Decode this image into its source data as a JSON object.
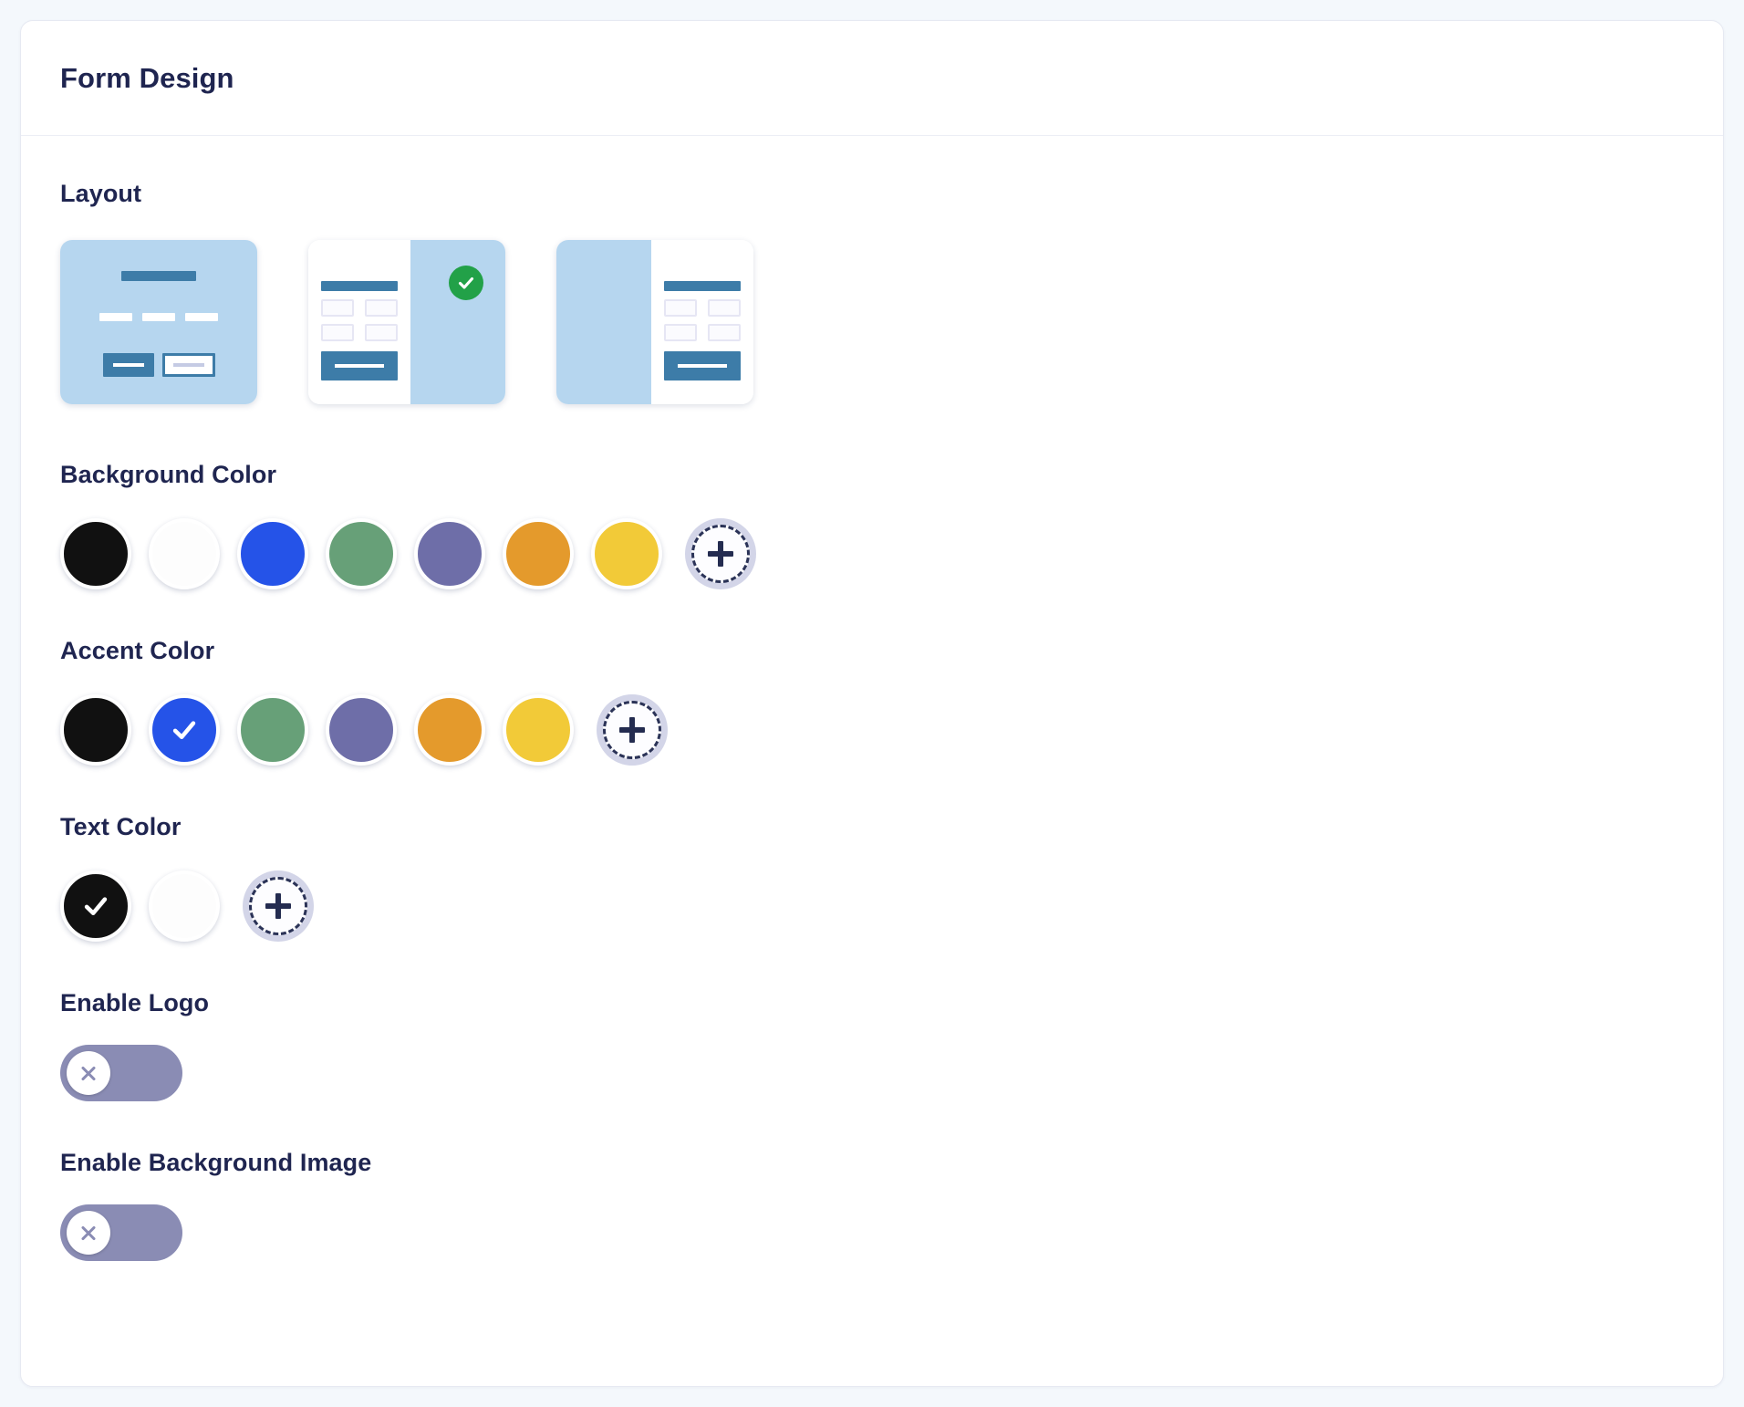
{
  "header": {
    "title": "Form Design"
  },
  "sections": {
    "layout": {
      "label": "Layout",
      "options": [
        {
          "name": "centered-layout",
          "selected": false
        },
        {
          "name": "form-left-image-right-layout",
          "selected": true
        },
        {
          "name": "image-left-form-right-layout",
          "selected": false
        }
      ],
      "selected_index": 1,
      "selected_badge_icon": "check-icon"
    },
    "background_color": {
      "label": "Background Color",
      "swatches": [
        {
          "name": "black",
          "hex": "#111111",
          "selected": false
        },
        {
          "name": "white",
          "hex": "#fdfdfd",
          "selected": false
        },
        {
          "name": "blue",
          "hex": "#2553e8",
          "selected": false
        },
        {
          "name": "green",
          "hex": "#67a078",
          "selected": false
        },
        {
          "name": "purple",
          "hex": "#6e6ea8",
          "selected": false
        },
        {
          "name": "orange",
          "hex": "#e49a2c",
          "selected": false
        },
        {
          "name": "yellow",
          "hex": "#f2ca38",
          "selected": false
        }
      ],
      "add_label": "+",
      "add_icon": "plus-icon"
    },
    "accent_color": {
      "label": "Accent Color",
      "swatches": [
        {
          "name": "black",
          "hex": "#111111",
          "selected": false
        },
        {
          "name": "blue",
          "hex": "#2553e8",
          "selected": true
        },
        {
          "name": "green",
          "hex": "#67a078",
          "selected": false
        },
        {
          "name": "purple",
          "hex": "#6e6ea8",
          "selected": false
        },
        {
          "name": "orange",
          "hex": "#e49a2c",
          "selected": false
        },
        {
          "name": "yellow",
          "hex": "#f2ca38",
          "selected": false
        }
      ],
      "add_label": "+",
      "add_icon": "plus-icon"
    },
    "text_color": {
      "label": "Text Color",
      "swatches": [
        {
          "name": "black",
          "hex": "#111111",
          "selected": true
        },
        {
          "name": "white",
          "hex": "#fdfdfd",
          "selected": false
        }
      ],
      "add_label": "+",
      "add_icon": "plus-icon"
    },
    "enable_logo": {
      "label": "Enable Logo",
      "state": "off",
      "knob_icon": "close-x-icon"
    },
    "enable_background_image": {
      "label": "Enable Background Image",
      "state": "off",
      "knob_icon": "close-x-icon"
    }
  },
  "colors": {
    "page_background": "#f4f8fc",
    "card_background": "#ffffff",
    "title_text": "#1f2550",
    "thumb_blue": "#b6d6ef",
    "thumb_accent": "#3d7ca8",
    "badge_green": "#22a148",
    "toggle_track_off": "#8a8cb4",
    "add_ring": "#d3d5e8"
  }
}
